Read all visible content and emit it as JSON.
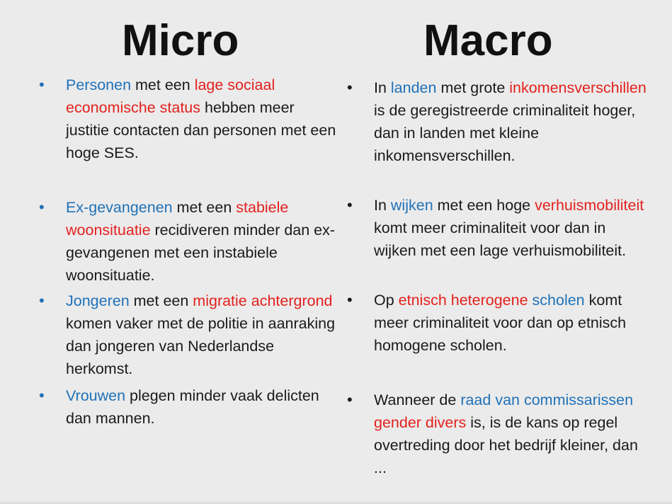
{
  "headings": {
    "micro": "Micro",
    "macro": "Macro"
  },
  "colors": {
    "blue": "#2072b8",
    "red": "#e3211e",
    "text": "#1a1a1a"
  },
  "bullet_glyph": "•",
  "micro": [
    {
      "segments": [
        {
          "text": "Personen",
          "color": "blue"
        },
        {
          "text": " met een ",
          "color": "black"
        },
        {
          "text": "lage sociaal economische status",
          "color": "red"
        },
        {
          "text": " hebben meer justitie contacten dan personen met een hoge SES.",
          "color": "black"
        }
      ]
    },
    {
      "segments": [
        {
          "text": "Ex-gevangenen",
          "color": "blue"
        },
        {
          "text": " met een ",
          "color": "black"
        },
        {
          "text": "stabiele woonsituatie",
          "color": "red"
        },
        {
          "text": " recidiveren minder dan ex-gevangenen met een instabiele woonsituatie.",
          "color": "black"
        }
      ]
    },
    {
      "segments": [
        {
          "text": "Jongeren",
          "color": "blue"
        },
        {
          "text": " met een ",
          "color": "black"
        },
        {
          "text": "migratie achtergrond",
          "color": "red"
        },
        {
          "text": " komen vaker met de politie in aanraking dan jongeren van Nederlandse herkomst.",
          "color": "black"
        }
      ]
    },
    {
      "segments": [
        {
          "text": "Vrouwen",
          "color": "blue"
        },
        {
          "text": " plegen minder vaak delicten dan mannen.",
          "color": "black"
        }
      ]
    }
  ],
  "macro": [
    {
      "segments": [
        {
          "text": "In ",
          "color": "black"
        },
        {
          "text": "landen",
          "color": "blue"
        },
        {
          "text": " met grote ",
          "color": "black"
        },
        {
          "text": "inkomensverschillen",
          "color": "red"
        },
        {
          "text": " is de geregistreerde criminaliteit hoger, dan in landen met kleine inkomensverschillen.",
          "color": "black"
        }
      ]
    },
    {
      "segments": [
        {
          "text": "In ",
          "color": "black"
        },
        {
          "text": "wijken",
          "color": "blue"
        },
        {
          "text": " met een hoge ",
          "color": "black"
        },
        {
          "text": "verhuismobiliteit",
          "color": "red"
        },
        {
          "text": " komt meer criminaliteit voor dan in wijken met een lage verhuismobiliteit.",
          "color": "black"
        }
      ]
    },
    {
      "segments": [
        {
          "text": "Op ",
          "color": "black"
        },
        {
          "text": "etnisch heterogene",
          "color": "red"
        },
        {
          "text": " ",
          "color": "black"
        },
        {
          "text": "scholen",
          "color": "blue"
        },
        {
          "text": " komt meer criminaliteit voor dan op etnisch homogene scholen.",
          "color": "black"
        }
      ]
    },
    {
      "segments": [
        {
          "text": "Wanneer de ",
          "color": "black"
        },
        {
          "text": "raad van commissarissen",
          "color": "blue"
        },
        {
          "text": " ",
          "color": "black"
        },
        {
          "text": "gender divers",
          "color": "red"
        },
        {
          "text": " is, is de kans op regel overtreding door het bedrijf kleiner, dan ...",
          "color": "black"
        }
      ]
    }
  ]
}
